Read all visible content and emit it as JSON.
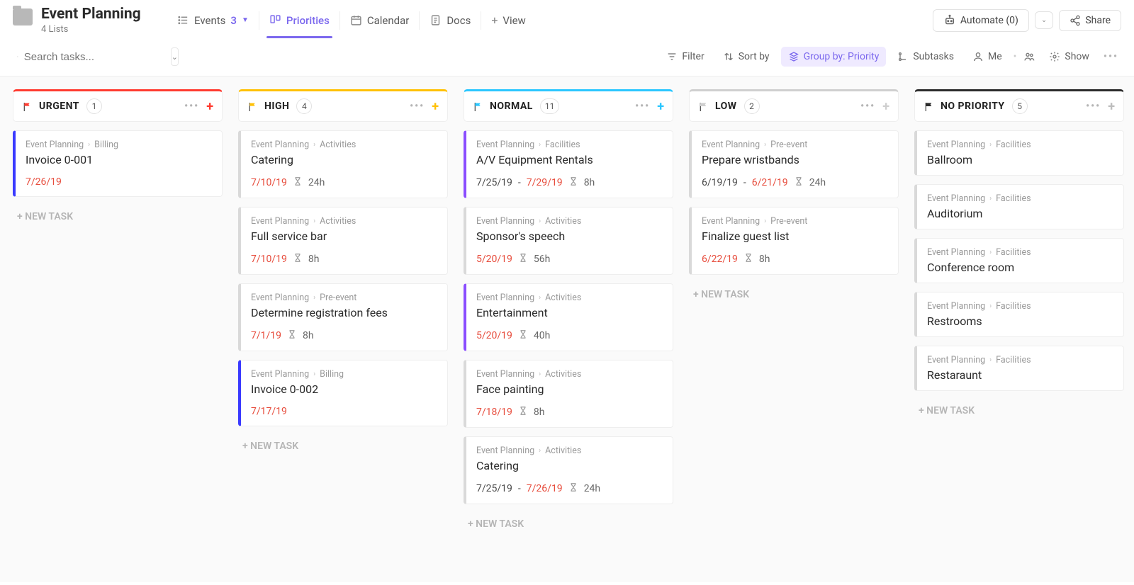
{
  "header": {
    "title": "Event Planning",
    "subtitle": "4 Lists"
  },
  "views": {
    "events": {
      "label": "Events",
      "badge": "3"
    },
    "priorities": {
      "label": "Priorities"
    },
    "calendar": {
      "label": "Calendar"
    },
    "docs": {
      "label": "Docs"
    },
    "add": {
      "label": "View"
    }
  },
  "top_actions": {
    "automate": "Automate (0)",
    "share": "Share"
  },
  "toolbar": {
    "search_placeholder": "Search tasks...",
    "filter": "Filter",
    "sort": "Sort by",
    "group": "Group by: Priority",
    "subtasks": "Subtasks",
    "me": "Me",
    "show": "Show"
  },
  "new_task_label": "+ NEW TASK",
  "columns": [
    {
      "id": "urgent",
      "title": "URGENT",
      "count": "1",
      "color": "#ff3b30",
      "plus_color": "#ff3b30",
      "flag_fill": "#ff3b30",
      "cards": [
        {
          "crumb1": "Event Planning",
          "crumb2": "Billing",
          "title": "Invoice 0-001",
          "date1": "7/26/19",
          "date1_red": true,
          "stripe": "#3a3aff"
        }
      ]
    },
    {
      "id": "high",
      "title": "HIGH",
      "count": "4",
      "color": "#ffc107",
      "plus_color": "#ffc107",
      "flag_fill": "#ffc107",
      "cards": [
        {
          "crumb1": "Event Planning",
          "crumb2": "Activities",
          "title": "Catering",
          "date1": "7/10/19",
          "date1_red": true,
          "est": "24h",
          "stripe": "#d9d9d9"
        },
        {
          "crumb1": "Event Planning",
          "crumb2": "Activities",
          "title": "Full service bar",
          "date1": "7/10/19",
          "date1_red": true,
          "est": "8h",
          "stripe": "#d9d9d9"
        },
        {
          "crumb1": "Event Planning",
          "crumb2": "Pre-event",
          "title": "Determine registration fees",
          "date1": "7/1/19",
          "date1_red": true,
          "est": "8h",
          "stripe": "#d9d9d9"
        },
        {
          "crumb1": "Event Planning",
          "crumb2": "Billing",
          "title": "Invoice 0-002",
          "date1": "7/17/19",
          "date1_red": true,
          "stripe": "#3a3aff"
        }
      ]
    },
    {
      "id": "normal",
      "title": "NORMAL",
      "count": "11",
      "color": "#2bc7ff",
      "plus_color": "#2bc7ff",
      "flag_fill": "#2bc7ff",
      "cards": [
        {
          "crumb1": "Event Planning",
          "crumb2": "Facilities",
          "title": "A/V Equipment Rentals",
          "date1": "7/25/19",
          "date1_red": false,
          "date2": "7/29/19",
          "est": "8h",
          "stripe": "#8a4dff"
        },
        {
          "crumb1": "Event Planning",
          "crumb2": "Activities",
          "title": "Sponsor's speech",
          "date1": "5/20/19",
          "date1_red": true,
          "est": "56h",
          "stripe": "#d9d9d9"
        },
        {
          "crumb1": "Event Planning",
          "crumb2": "Activities",
          "title": "Entertainment",
          "date1": "5/20/19",
          "date1_red": true,
          "est": "40h",
          "stripe": "#8a4dff"
        },
        {
          "crumb1": "Event Planning",
          "crumb2": "Activities",
          "title": "Face painting",
          "date1": "7/18/19",
          "date1_red": true,
          "est": "8h",
          "stripe": "#d9d9d9"
        },
        {
          "crumb1": "Event Planning",
          "crumb2": "Activities",
          "title": "Catering",
          "date1": "7/25/19",
          "date1_red": false,
          "date2": "7/26/19",
          "est": "24h",
          "stripe": "#d9d9d9"
        }
      ]
    },
    {
      "id": "low",
      "title": "LOW",
      "count": "2",
      "color": "#cfcfcf",
      "plus_color": "#cfcfcf",
      "flag_fill": "#cfcfcf",
      "cards": [
        {
          "crumb1": "Event Planning",
          "crumb2": "Pre-event",
          "title": "Prepare wristbands",
          "date1": "6/19/19",
          "date1_red": false,
          "date2": "6/21/19",
          "est": "24h",
          "stripe": "#d9d9d9"
        },
        {
          "crumb1": "Event Planning",
          "crumb2": "Pre-event",
          "title": "Finalize guest list",
          "date1": "6/22/19",
          "date1_red": true,
          "est": "8h",
          "stripe": "#d9d9d9"
        }
      ]
    },
    {
      "id": "none",
      "title": "NO PRIORITY",
      "count": "5",
      "color": "#2b2b2b",
      "plus_color": "#bdbdbd",
      "flag_fill": "#2b2b2b",
      "cards": [
        {
          "crumb1": "Event Planning",
          "crumb2": "Facilities",
          "title": "Ballroom",
          "stripe": "#d9d9d9"
        },
        {
          "crumb1": "Event Planning",
          "crumb2": "Facilities",
          "title": "Auditorium",
          "stripe": "#d9d9d9"
        },
        {
          "crumb1": "Event Planning",
          "crumb2": "Facilities",
          "title": "Conference room",
          "stripe": "#d9d9d9"
        },
        {
          "crumb1": "Event Planning",
          "crumb2": "Facilities",
          "title": "Restrooms",
          "stripe": "#d9d9d9"
        },
        {
          "crumb1": "Event Planning",
          "crumb2": "Facilities",
          "title": "Restaraunt",
          "stripe": "#d9d9d9"
        }
      ]
    }
  ]
}
